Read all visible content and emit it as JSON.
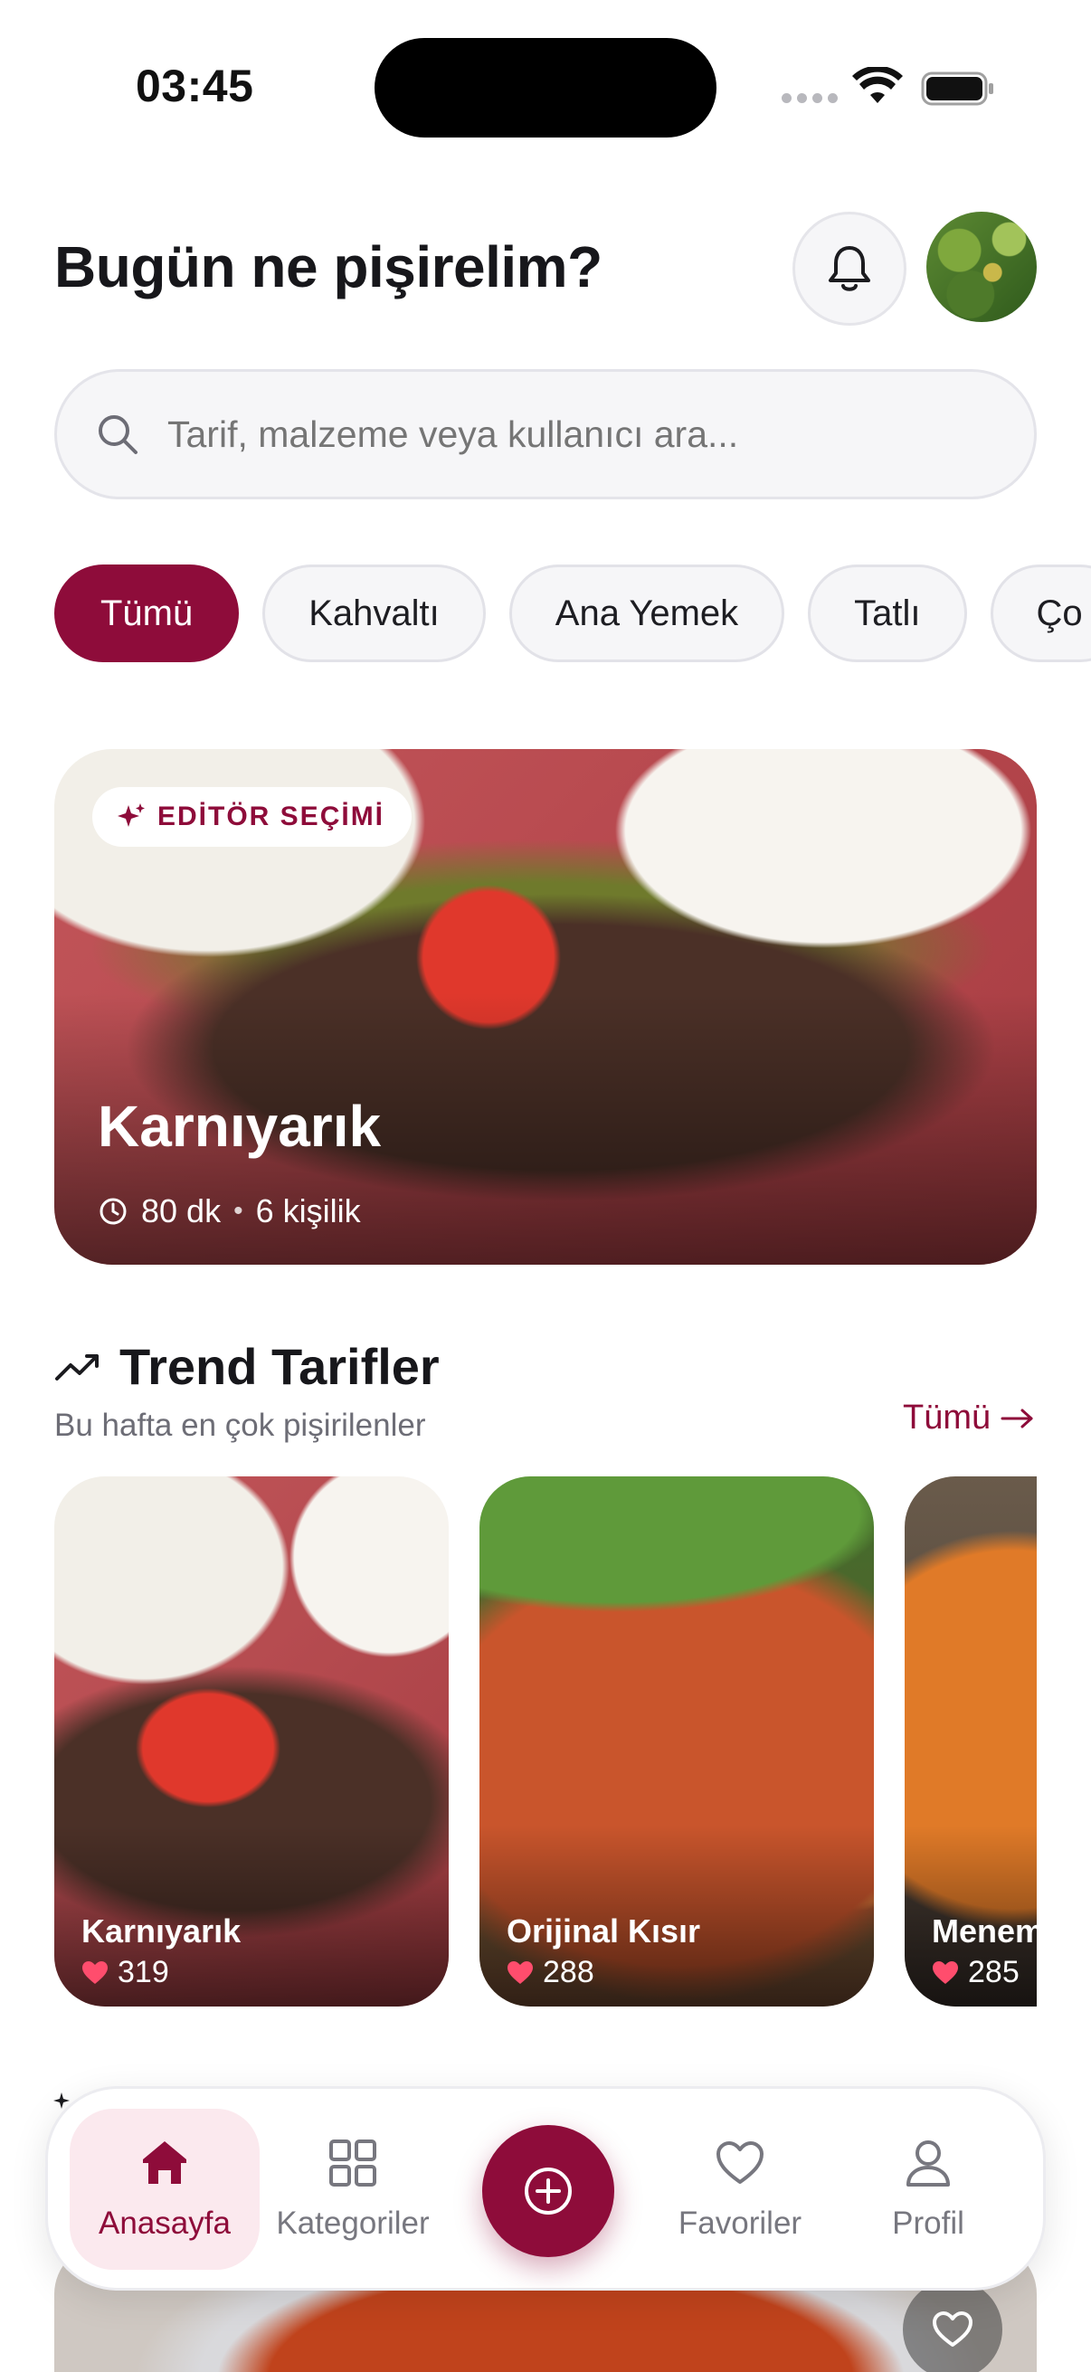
{
  "status_bar": {
    "time": "03:45"
  },
  "header": {
    "title": "Bugün ne pişirelim?"
  },
  "search": {
    "placeholder": "Tarif, malzeme veya kullanıcı ara..."
  },
  "categories": [
    {
      "label": "Tümü",
      "active": true
    },
    {
      "label": "Kahvaltı",
      "active": false
    },
    {
      "label": "Ana Yemek",
      "active": false
    },
    {
      "label": "Tatlı",
      "active": false
    },
    {
      "label": "Ço",
      "active": false
    }
  ],
  "hero": {
    "badge": "EDİTÖR SEÇİMİ",
    "title": "Karnıyarık",
    "duration": "80 dk",
    "separator": "•",
    "servings": "6 kişilik"
  },
  "trend": {
    "title": "Trend Tarifler",
    "subtitle": "Bu hafta en çok pişirilenler",
    "see_all": "Tümü",
    "cards": [
      {
        "name": "Karnıyarık",
        "likes": "319"
      },
      {
        "name": "Orijinal Kısır",
        "likes": "288"
      },
      {
        "name": "Menemen",
        "likes": "285"
      }
    ]
  },
  "nav": {
    "home": "Anasayfa",
    "categories": "Kategoriler",
    "favorites": "Favoriler",
    "profile": "Profil"
  },
  "colors": {
    "accent": "#8e0c3a",
    "accent_soft": "#fbe9ee",
    "like": "#ff4d6d"
  },
  "icons": [
    "bell-icon",
    "search-icon",
    "sparkle-icon",
    "clock-icon",
    "trend-icon",
    "arrow-right-icon",
    "heart-icon",
    "home-icon",
    "grid-icon",
    "plus-circle-icon",
    "user-icon"
  ]
}
